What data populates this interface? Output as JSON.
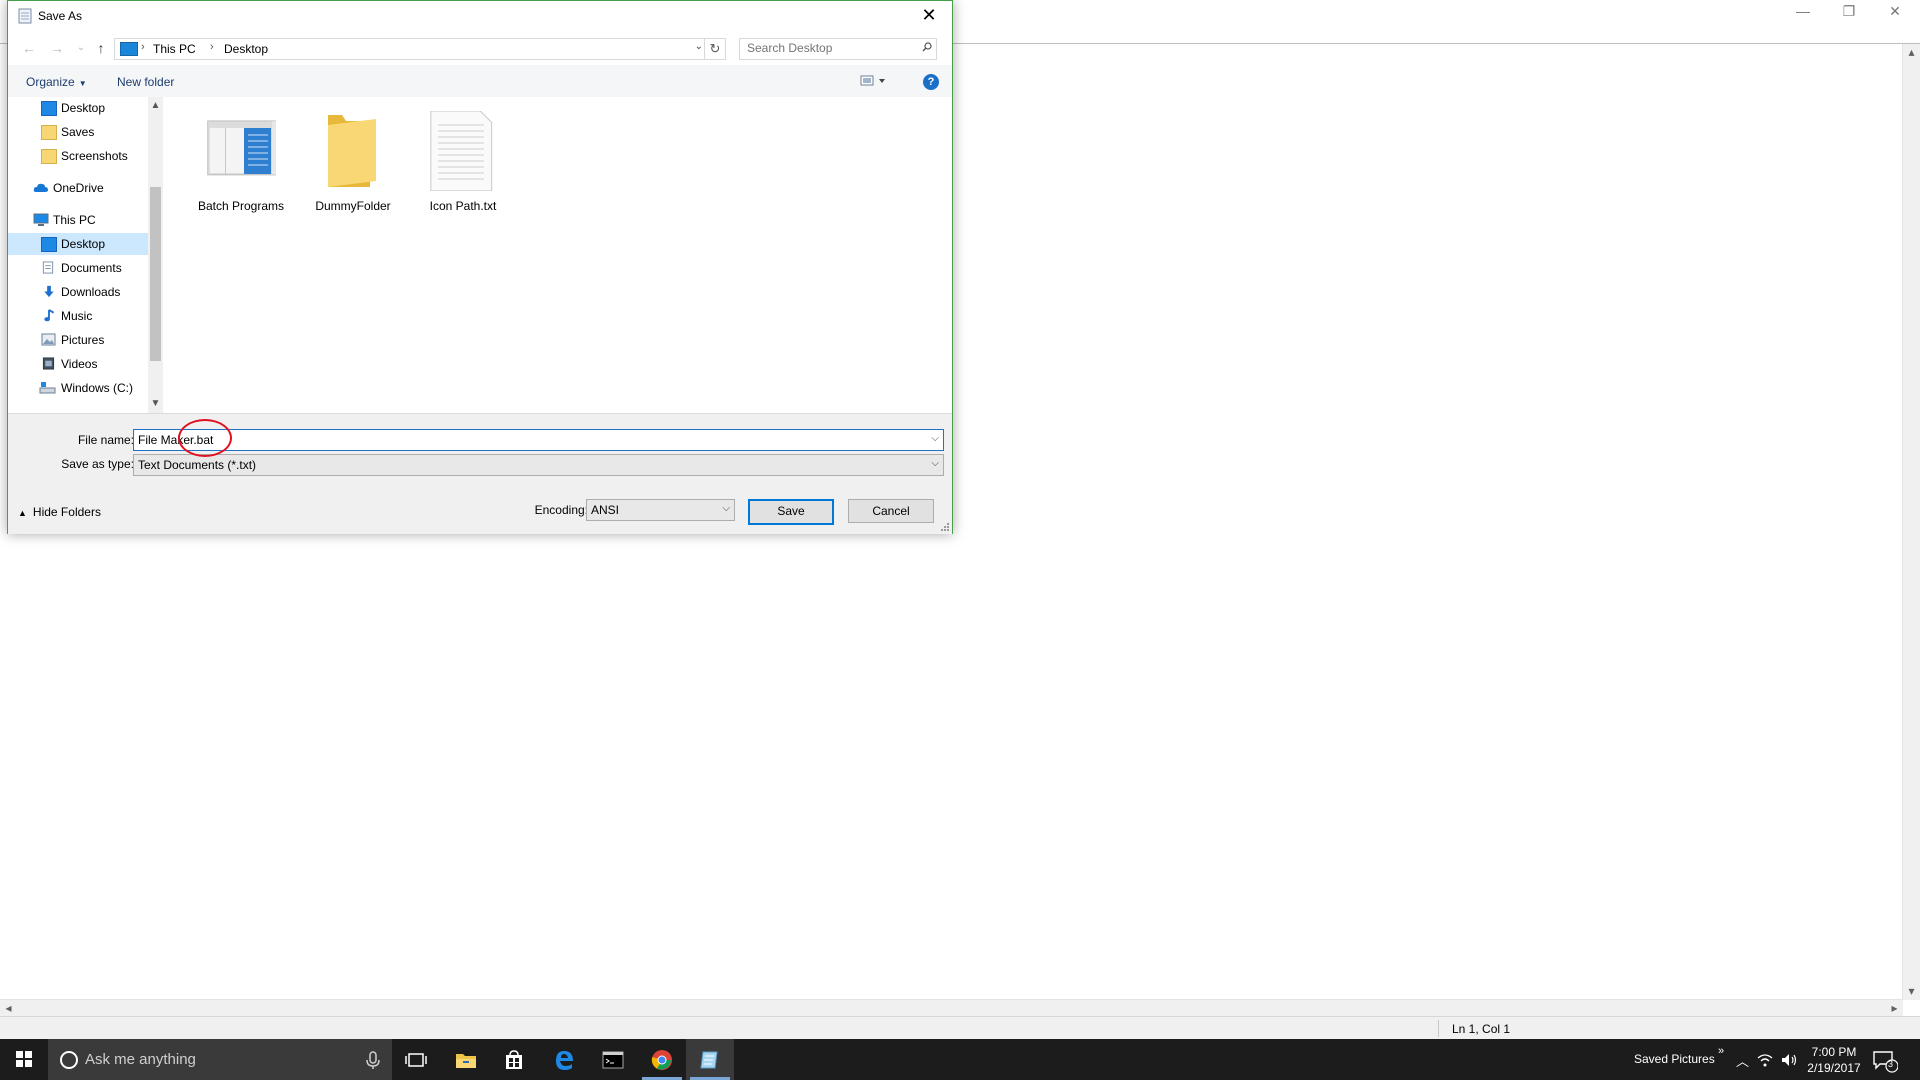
{
  "dialog": {
    "title": "Save As",
    "close_glyph": "✕",
    "nav": {
      "back": "←",
      "forward": "→",
      "recent": "⌄",
      "up": "↑"
    },
    "address": {
      "crumbs": [
        "This PC",
        "Desktop"
      ],
      "separator": "›",
      "dropdown": "⌄",
      "refresh": "↻"
    },
    "search": {
      "placeholder": "Search Desktop"
    },
    "toolbar": {
      "organize": "Organize",
      "new_folder": "New folder",
      "help": "?"
    },
    "nav_pane": {
      "items": [
        {
          "label": "Desktop",
          "icon": "desktop-icon"
        },
        {
          "label": "Saves",
          "icon": "folder-icon"
        },
        {
          "label": "Screenshots",
          "icon": "folder-icon"
        },
        {
          "label": "OneDrive",
          "icon": "onedrive-icon"
        },
        {
          "label": "This PC",
          "icon": "computer-icon"
        },
        {
          "label": "Desktop",
          "icon": "desktop-icon",
          "selected": true
        },
        {
          "label": "Documents",
          "icon": "documents-icon"
        },
        {
          "label": "Downloads",
          "icon": "downloads-icon"
        },
        {
          "label": "Music",
          "icon": "music-icon"
        },
        {
          "label": "Pictures",
          "icon": "pictures-icon"
        },
        {
          "label": "Videos",
          "icon": "videos-icon"
        },
        {
          "label": "Windows (C:)",
          "icon": "drive-icon"
        }
      ]
    },
    "files": [
      {
        "name": "Batch Programs",
        "icon": "folder-preview-icon"
      },
      {
        "name": "DummyFolder",
        "icon": "folder-icon"
      },
      {
        "name": "Icon Path.txt",
        "icon": "text-file-icon"
      }
    ],
    "form": {
      "file_name_label": "File name:",
      "file_name_value": "File Maker.bat",
      "save_type_label": "Save as type:",
      "save_type_value": "Text Documents (*.txt)",
      "encoding_label": "Encoding:",
      "encoding_value": "ANSI",
      "hide_folders": "Hide Folders",
      "save_button": "Save",
      "cancel_button": "Cancel"
    }
  },
  "notepad": {
    "status_position": "Ln 1, Col 1"
  },
  "taskbar": {
    "search_placeholder": "Ask me anything",
    "tray_label": "Saved Pictures",
    "tray_chevron": "»",
    "time": "7:00 PM",
    "date": "2/19/2017",
    "notification_count": "3"
  },
  "colors": {
    "accent": "#0078d7",
    "dialog_border": "#45a04a",
    "annotation": "#e0121f",
    "taskbar": "#1c1c1c"
  }
}
